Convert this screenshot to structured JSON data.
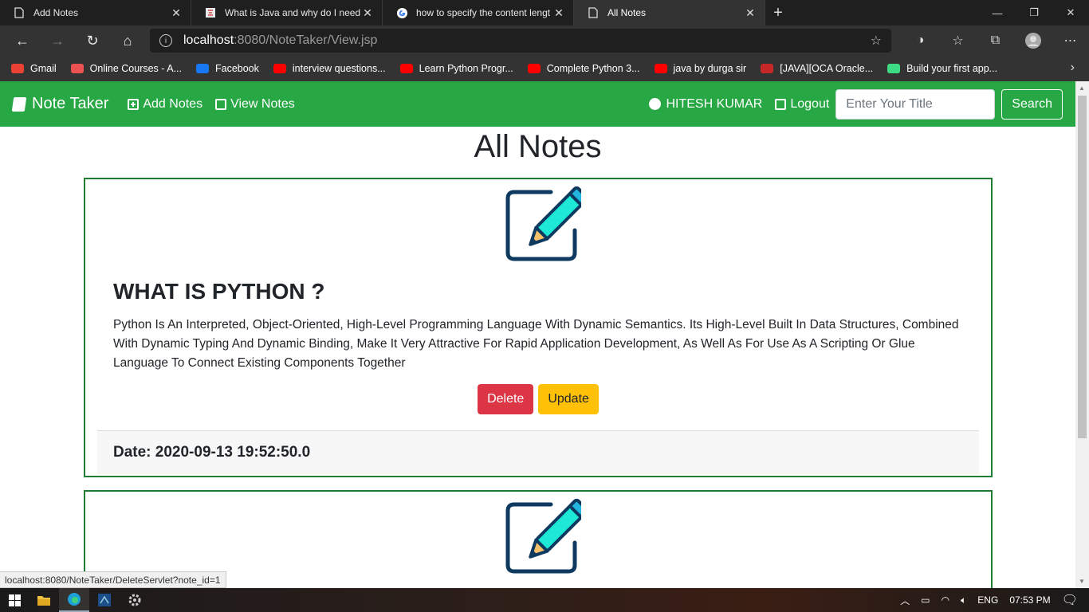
{
  "browser": {
    "tabs": [
      {
        "title": "Add Notes",
        "active": false,
        "icon": "page-icon"
      },
      {
        "title": "What is Java and why do I need t",
        "active": false,
        "icon": "java-icon"
      },
      {
        "title": "how to specify the content lengt",
        "active": false,
        "icon": "google-icon"
      },
      {
        "title": "All Notes",
        "active": true,
        "icon": "page-icon"
      }
    ],
    "url_host": "localhost",
    "url_path": ":8080/NoteTaker/View.jsp",
    "bookmarks": [
      {
        "label": "Gmail",
        "icon": "gmail-icon",
        "color": "#ea4335"
      },
      {
        "label": "Online Courses - A...",
        "icon": "udemy-icon",
        "color": "#ec5252"
      },
      {
        "label": "Facebook",
        "icon": "facebook-icon",
        "color": "#1877f2"
      },
      {
        "label": "interview questions...",
        "icon": "youtube-icon",
        "color": "#ff0000"
      },
      {
        "label": "Learn Python Progr...",
        "icon": "youtube-icon",
        "color": "#ff0000"
      },
      {
        "label": "Complete Python 3...",
        "icon": "youtube-icon",
        "color": "#ff0000"
      },
      {
        "label": "java by durga sir",
        "icon": "youtube-icon",
        "color": "#ff0000"
      },
      {
        "label": "[JAVA][OCA Oracle...",
        "icon": "pdf-icon",
        "color": "#c62828"
      },
      {
        "label": "Build your first app...",
        "icon": "android-icon",
        "color": "#3ddc84"
      }
    ],
    "status_url": "localhost:8080/NoteTaker/DeleteServlet?note_id=1"
  },
  "navbar": {
    "brand": "Note Taker",
    "add_notes": "Add Notes",
    "view_notes": "View Notes",
    "user": "HITESH KUMAR",
    "logout": "Logout",
    "search_placeholder": "Enter Your Title",
    "search_button": "Search",
    "color": "#28a745"
  },
  "page": {
    "heading": "All Notes"
  },
  "notes": [
    {
      "title": "WHAT IS PYTHON ?",
      "content": "Python Is An Interpreted, Object-Oriented, High-Level Programming Language With Dynamic Semantics. Its High-Level Built In Data Structures, Combined With Dynamic Typing And Dynamic Binding, Make It Very Attractive For Rapid Application Development, As Well As For Use As A Scripting Or Glue Language To Connect Existing Components Together",
      "delete_label": "Delete",
      "update_label": "Update",
      "date": "Date: 2020-09-13 19:52:50.0"
    }
  ],
  "taskbar": {
    "language": "ENG",
    "time": "07:53 PM"
  }
}
